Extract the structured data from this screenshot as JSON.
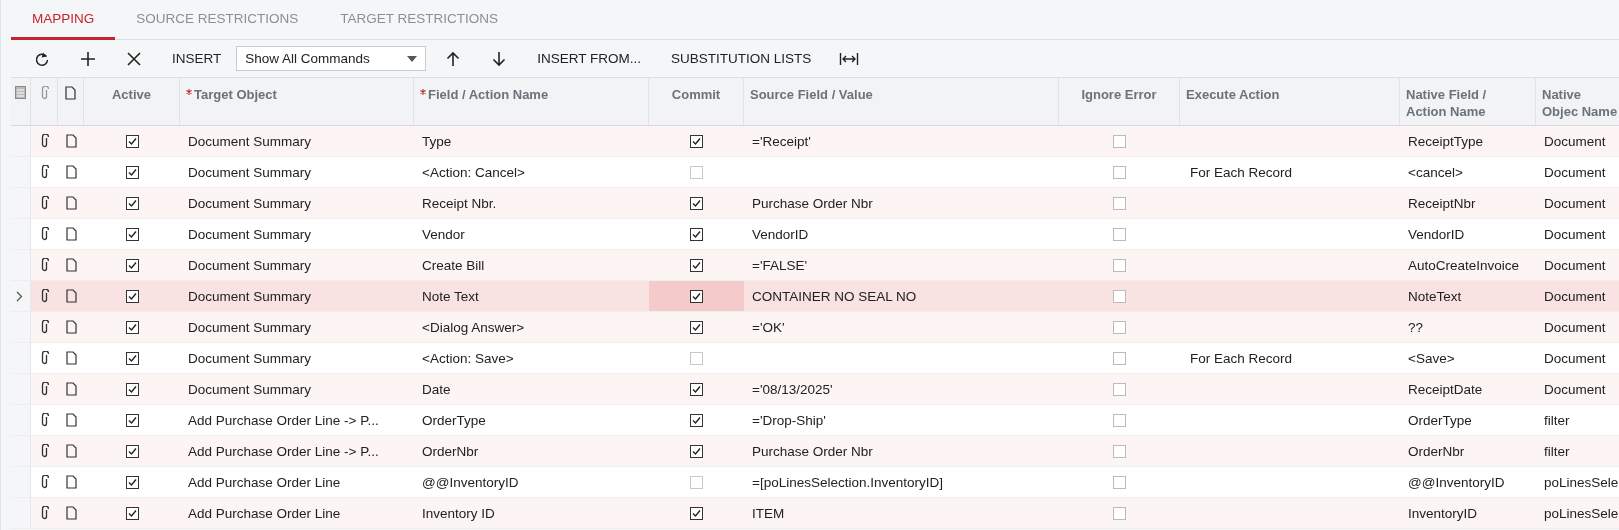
{
  "tabs": [
    {
      "label": "MAPPING",
      "selected": true
    },
    {
      "label": "SOURCE RESTRICTIONS",
      "selected": false
    },
    {
      "label": "TARGET RESTRICTIONS",
      "selected": false
    }
  ],
  "toolbar": {
    "insert_button": "INSERT",
    "command_filter": {
      "value": "Show All Commands"
    },
    "insert_from_button": "INSERT FROM...",
    "substitution_lists_button": "SUBSTITUTION LISTS"
  },
  "columns": [
    {
      "label": "Active",
      "required": false
    },
    {
      "label": "Target Object",
      "required": true
    },
    {
      "label": "Field / Action Name",
      "required": true
    },
    {
      "label": "Commit",
      "required": false
    },
    {
      "label": "Source Field / Value",
      "required": false
    },
    {
      "label": "Ignore Error",
      "required": false
    },
    {
      "label": "Execute Action",
      "required": false
    },
    {
      "label": "Native Field / Action Name",
      "required": false
    },
    {
      "label": "Native Objec Name",
      "required": false
    }
  ],
  "rows": [
    {
      "selected": false,
      "commit_focused": false,
      "active": true,
      "target_object": "Document Summary",
      "field_action_name": "Type",
      "commit": true,
      "source_value": "='Receipt'",
      "ignore_error": false,
      "execute_action": "",
      "native_field": "ReceiptType",
      "native_object": "Document"
    },
    {
      "selected": false,
      "commit_focused": false,
      "active": true,
      "target_object": "Document Summary",
      "field_action_name": "<Action: Cancel>",
      "commit": false,
      "source_value": "",
      "ignore_error": false,
      "execute_action": "For Each Record",
      "native_field": "<cancel>",
      "native_object": "Document"
    },
    {
      "selected": false,
      "commit_focused": false,
      "active": true,
      "target_object": "Document Summary",
      "field_action_name": "Receipt Nbr.",
      "commit": true,
      "source_value": "Purchase Order Nbr",
      "ignore_error": false,
      "execute_action": "",
      "native_field": "ReceiptNbr",
      "native_object": "Document"
    },
    {
      "selected": false,
      "commit_focused": false,
      "active": true,
      "target_object": "Document Summary",
      "field_action_name": "Vendor",
      "commit": true,
      "source_value": "VendorID",
      "ignore_error": false,
      "execute_action": "",
      "native_field": "VendorID",
      "native_object": "Document"
    },
    {
      "selected": false,
      "commit_focused": false,
      "active": true,
      "target_object": "Document Summary",
      "field_action_name": "Create Bill",
      "commit": true,
      "source_value": "='FALSE'",
      "ignore_error": false,
      "execute_action": "",
      "native_field": "AutoCreateInvoice",
      "native_object": "Document"
    },
    {
      "selected": true,
      "commit_focused": true,
      "active": true,
      "target_object": "Document Summary",
      "field_action_name": "Note Text",
      "commit": true,
      "source_value": "CONTAINER NO SEAL NO",
      "ignore_error": false,
      "execute_action": "",
      "native_field": "NoteText",
      "native_object": "Document"
    },
    {
      "selected": false,
      "commit_focused": false,
      "active": true,
      "target_object": "Document Summary",
      "field_action_name": "<Dialog Answer>",
      "commit": true,
      "source_value": "='OK'",
      "ignore_error": false,
      "execute_action": "",
      "native_field": "??",
      "native_object": "Document"
    },
    {
      "selected": false,
      "commit_focused": false,
      "active": true,
      "target_object": "Document Summary",
      "field_action_name": "<Action: Save>",
      "commit": false,
      "source_value": "",
      "ignore_error": false,
      "execute_action": "For Each Record",
      "native_field": "<Save>",
      "native_object": "Document"
    },
    {
      "selected": false,
      "commit_focused": false,
      "active": true,
      "target_object": "Document Summary",
      "field_action_name": "Date",
      "commit": true,
      "source_value": "='08/13/2025'",
      "ignore_error": false,
      "execute_action": "",
      "native_field": "ReceiptDate",
      "native_object": "Document"
    },
    {
      "selected": false,
      "commit_focused": false,
      "active": true,
      "target_object": "Add Purchase Order Line -> P...",
      "field_action_name": "OrderType",
      "commit": true,
      "source_value": "='Drop-Ship'",
      "ignore_error": false,
      "execute_action": "",
      "native_field": "OrderType",
      "native_object": "filter"
    },
    {
      "selected": false,
      "commit_focused": false,
      "active": true,
      "target_object": "Add Purchase Order Line -> P...",
      "field_action_name": "OrderNbr",
      "commit": true,
      "source_value": "Purchase Order Nbr",
      "ignore_error": false,
      "execute_action": "",
      "native_field": "OrderNbr",
      "native_object": "filter"
    },
    {
      "selected": false,
      "commit_focused": false,
      "active": true,
      "target_object": "Add Purchase Order Line",
      "field_action_name": "@@InventoryID",
      "commit": false,
      "source_value": "=[poLinesSelection.InventoryID]",
      "ignore_error": false,
      "execute_action": "",
      "native_field": "@@InventoryID",
      "native_object": "poLinesSele"
    },
    {
      "selected": false,
      "commit_focused": false,
      "active": true,
      "target_object": "Add Purchase Order Line",
      "field_action_name": "Inventory ID",
      "commit": true,
      "source_value": "ITEM",
      "ignore_error": false,
      "execute_action": "",
      "native_field": "InventoryID",
      "native_object": "poLinesSele"
    }
  ]
}
